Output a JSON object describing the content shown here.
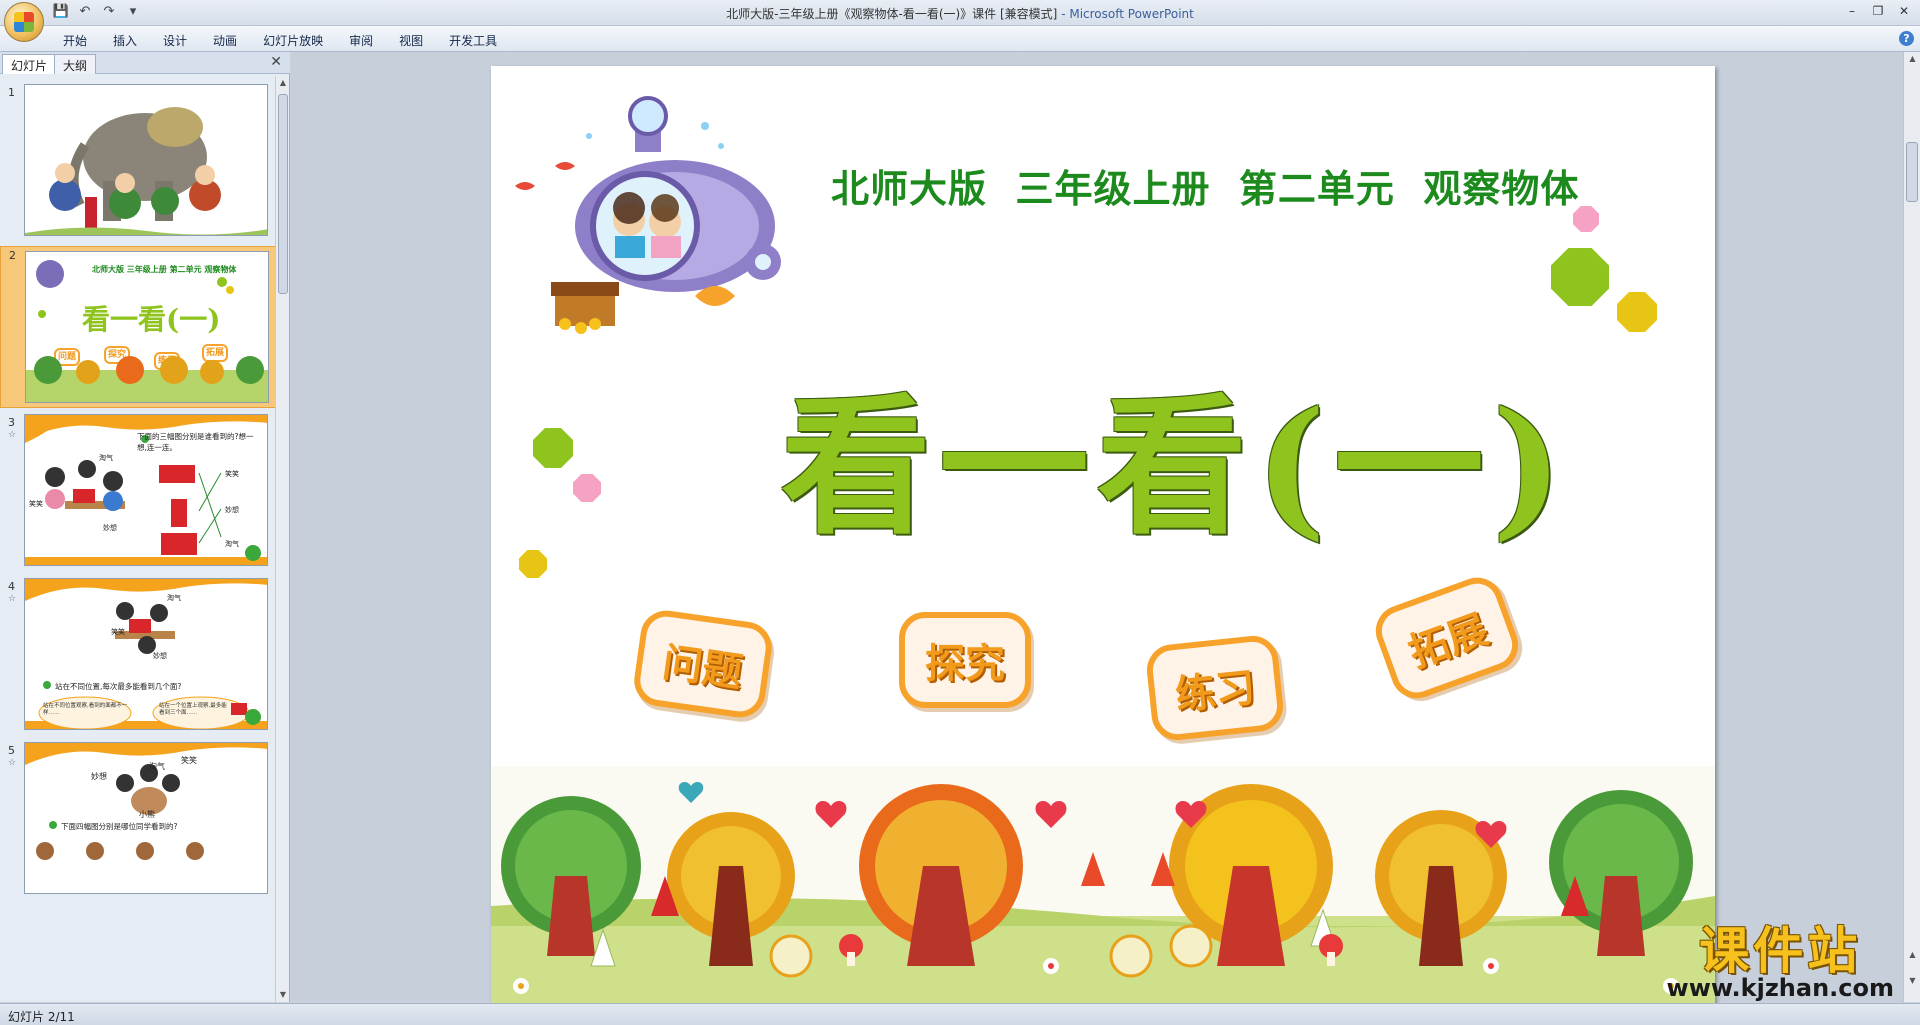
{
  "window": {
    "title": "北师大版-三年级上册《观察物体-看一看(一)》课件 [兼容模式]",
    "app_suffix": " - Microsoft PowerPoint",
    "minimize": "–",
    "restore": "❐",
    "close": "✕"
  },
  "quick_access": {
    "save": "💾",
    "undo": "↶",
    "redo": "↷",
    "customize": "▾"
  },
  "ribbon": {
    "tabs": [
      "开始",
      "插入",
      "设计",
      "动画",
      "幻灯片放映",
      "审阅",
      "视图",
      "开发工具"
    ],
    "help": "?"
  },
  "left_pane": {
    "tabs": [
      "幻灯片",
      "大纲"
    ],
    "close": "✕",
    "slides": [
      {
        "num": "1",
        "star": ""
      },
      {
        "num": "2",
        "star": ""
      },
      {
        "num": "3",
        "star": "☆"
      },
      {
        "num": "4",
        "star": "☆"
      },
      {
        "num": "5",
        "star": "☆"
      }
    ],
    "thumb3": {
      "text": "下面的三幅图分别是谁看到的?想一想,连一连。",
      "labels": [
        "淘气",
        "笑笑",
        "妙想",
        "笑笑",
        "妙想",
        "淘气"
      ]
    },
    "thumb4": {
      "text": "站在不同位置,每次最多能看到几个面?",
      "bubble1": "站在不同位置观察,看到的面都不一样……",
      "bubble2": "站在一个位置上观察,最多能看到三个面……",
      "labels": [
        "淘气",
        "笑笑",
        "妙想"
      ]
    },
    "thumb5": {
      "text": "下面四幅图分别是哪位同学看到的?",
      "labels": [
        "笑笑",
        "淘气",
        "妙想",
        "小熊"
      ]
    },
    "thumb2": {
      "subtitle": "北师大版 三年级上册 第二单元 观察物体",
      "title": "看一看(一)",
      "badges": [
        "问题",
        "探究",
        "练习",
        "拓展"
      ]
    }
  },
  "slide": {
    "subtitle": "北师大版  三年级上册  第二单元  观察物体",
    "title": "看一看(一)",
    "badges": [
      "问题",
      "探究",
      "练习",
      "拓展"
    ],
    "colors": {
      "green": "#1d8a1d",
      "title_green": "#8fc41e",
      "orange": "#f7a22a"
    }
  },
  "status": {
    "slide_counter": "幻灯片 2/11"
  },
  "watermark": {
    "big": "课件站",
    "small": "www.kjzhan.com"
  }
}
